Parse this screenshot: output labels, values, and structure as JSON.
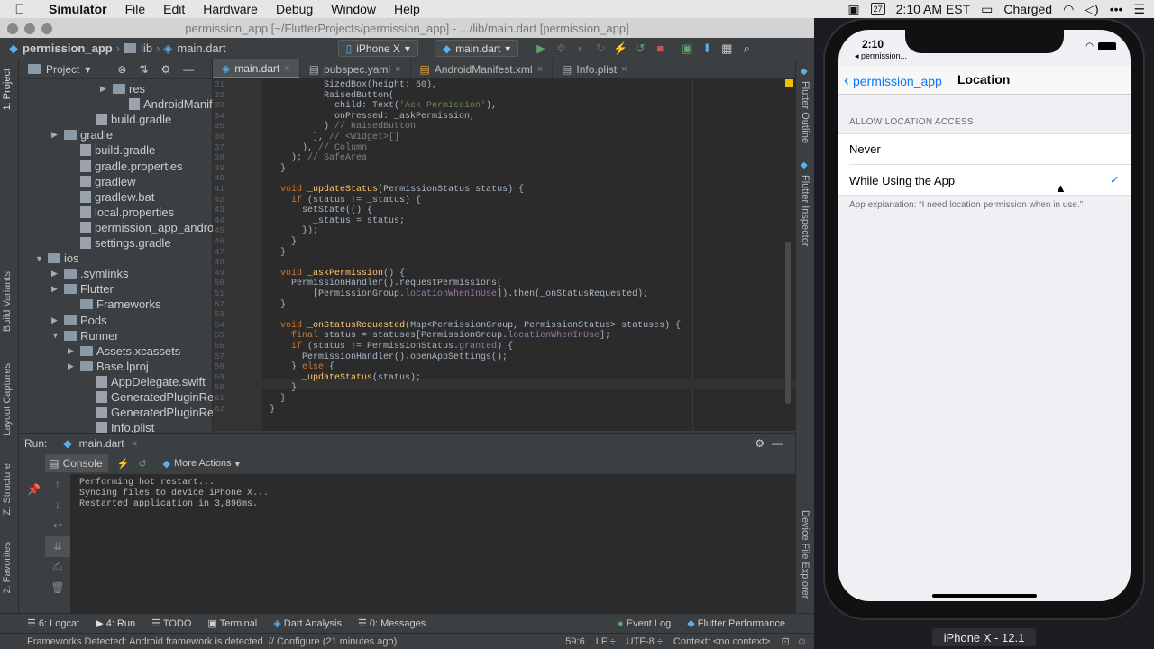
{
  "menubar": {
    "apple": "",
    "app": "Simulator",
    "items": [
      "File",
      "Edit",
      "Hardware",
      "Debug",
      "Window",
      "Help"
    ],
    "right": {
      "date_badge": "27",
      "clock": "2:10 AM EST",
      "battery": "Charged"
    }
  },
  "ide": {
    "title": "permission_app [~/FlutterProjects/permission_app] - .../lib/main.dart [permission_app]",
    "nav": {
      "crumbs": [
        "permission_app",
        "lib",
        "main.dart"
      ],
      "device": "iPhone X",
      "run_config": "main.dart"
    },
    "project": {
      "header": "Project",
      "tree": [
        {
          "label": "res",
          "depth": 5,
          "arrow": "▶",
          "kind": "folder"
        },
        {
          "label": "AndroidManifest.xml",
          "depth": 6,
          "arrow": "",
          "kind": "file"
        },
        {
          "label": "build.gradle",
          "depth": 4,
          "arrow": "",
          "kind": "file"
        },
        {
          "label": "gradle",
          "depth": 2,
          "arrow": "▶",
          "kind": "folder"
        },
        {
          "label": "build.gradle",
          "depth": 3,
          "arrow": "",
          "kind": "file"
        },
        {
          "label": "gradle.properties",
          "depth": 3,
          "arrow": "",
          "kind": "file"
        },
        {
          "label": "gradlew",
          "depth": 3,
          "arrow": "",
          "kind": "file"
        },
        {
          "label": "gradlew.bat",
          "depth": 3,
          "arrow": "",
          "kind": "file"
        },
        {
          "label": "local.properties",
          "depth": 3,
          "arrow": "",
          "kind": "file"
        },
        {
          "label": "permission_app_android",
          "depth": 3,
          "arrow": "",
          "kind": "file"
        },
        {
          "label": "settings.gradle",
          "depth": 3,
          "arrow": "",
          "kind": "file"
        },
        {
          "label": "ios",
          "depth": 1,
          "arrow": "▼",
          "kind": "folder"
        },
        {
          "label": ".symlinks",
          "depth": 2,
          "arrow": "▶",
          "kind": "folder"
        },
        {
          "label": "Flutter",
          "depth": 2,
          "arrow": "▶",
          "kind": "folder"
        },
        {
          "label": "Frameworks",
          "depth": 3,
          "arrow": "",
          "kind": "folder"
        },
        {
          "label": "Pods",
          "depth": 2,
          "arrow": "▶",
          "kind": "folder"
        },
        {
          "label": "Runner",
          "depth": 2,
          "arrow": "▼",
          "kind": "folder"
        },
        {
          "label": "Assets.xcassets",
          "depth": 3,
          "arrow": "▶",
          "kind": "folder"
        },
        {
          "label": "Base.lproj",
          "depth": 3,
          "arrow": "▶",
          "kind": "folder"
        },
        {
          "label": "AppDelegate.swift",
          "depth": 4,
          "arrow": "",
          "kind": "file"
        },
        {
          "label": "GeneratedPluginRegistrant.h",
          "depth": 4,
          "arrow": "",
          "kind": "file"
        },
        {
          "label": "GeneratedPluginRegistrant.m",
          "depth": 4,
          "arrow": "",
          "kind": "file"
        },
        {
          "label": "Info.plist",
          "depth": 4,
          "arrow": "",
          "kind": "file"
        }
      ]
    },
    "tabs": [
      {
        "label": "main.dart",
        "active": true
      },
      {
        "label": "pubspec.yaml",
        "active": false
      },
      {
        "label": "AndroidManifest.xml",
        "active": false
      },
      {
        "label": "Info.plist",
        "active": false
      }
    ],
    "code": {
      "lines": [
        {
          "n": "31",
          "t": "          SizedBox(height: 60),"
        },
        {
          "n": "32",
          "t": "          RaisedButton("
        },
        {
          "n": "33",
          "t": "            child: Text('Ask Permission'),"
        },
        {
          "n": "34",
          "t": "            onPressed: _askPermission,"
        },
        {
          "n": "35",
          "t": "          ) // RaisedButton"
        },
        {
          "n": "36",
          "t": "        ], // <Widget>[]"
        },
        {
          "n": "37",
          "t": "      ), // Column"
        },
        {
          "n": "38",
          "t": "    ); // SafeArea"
        },
        {
          "n": "39",
          "t": "  }"
        },
        {
          "n": "40",
          "t": ""
        },
        {
          "n": "41",
          "t": "  void _updateStatus(PermissionStatus status) {"
        },
        {
          "n": "42",
          "t": "    if (status != _status) {"
        },
        {
          "n": "43",
          "t": "      setState(() {"
        },
        {
          "n": "44",
          "t": "        _status = status;"
        },
        {
          "n": "45",
          "t": "      });"
        },
        {
          "n": "46",
          "t": "    }"
        },
        {
          "n": "47",
          "t": "  }"
        },
        {
          "n": "48",
          "t": ""
        },
        {
          "n": "49",
          "t": "  void _askPermission() {"
        },
        {
          "n": "50",
          "t": "    PermissionHandler().requestPermissions("
        },
        {
          "n": "51",
          "t": "        [PermissionGroup.locationWhenInUse]).then(_onStatusRequested);"
        },
        {
          "n": "52",
          "t": "  }"
        },
        {
          "n": "53",
          "t": ""
        },
        {
          "n": "54",
          "t": "  void _onStatusRequested(Map<PermissionGroup, PermissionStatus> statuses) {"
        },
        {
          "n": "55",
          "t": "    final status = statuses[PermissionGroup.locationWhenInUse];"
        },
        {
          "n": "56",
          "t": "    if (status != PermissionStatus.granted) {"
        },
        {
          "n": "57",
          "t": "      PermissionHandler().openAppSettings();"
        },
        {
          "n": "58",
          "t": "    } else {"
        },
        {
          "n": "59",
          "t": "      _updateStatus(status);"
        },
        {
          "n": "60",
          "t": "    }"
        },
        {
          "n": "61",
          "t": "  }"
        },
        {
          "n": "62",
          "t": "}"
        }
      ]
    },
    "side_tabs": {
      "left": [
        "1: Project",
        "Build Variants",
        "Layout Captures",
        "Z: Structure",
        "2: Favorites"
      ],
      "right": [
        "Flutter Outline",
        "Flutter Inspector",
        "Device File Explorer"
      ]
    },
    "run": {
      "label": "Run:",
      "config": "main.dart",
      "console_tab": "Console",
      "more_actions": "More Actions",
      "output": [
        "Performing hot restart...",
        "Syncing files to device iPhone X...",
        "Restarted application in 3,896ms."
      ]
    },
    "bottom_tabs": [
      "6: Logcat",
      "4: Run",
      "TODO",
      "Terminal",
      "Dart Analysis",
      "0: Messages"
    ],
    "bottom_right": [
      "Event Log",
      "Flutter Performance"
    ],
    "status": {
      "message": "Frameworks Detected: Android framework is detected. // Configure (21 minutes ago)",
      "position": "59:6",
      "line_sep": "LF ÷",
      "encoding": "UTF-8 ÷",
      "context": "Context: <no context>"
    }
  },
  "sim": {
    "time": "2:10",
    "back_app": "◂ permission...",
    "nav_back": "permission_app",
    "nav_title": "Location",
    "section": "ALLOW LOCATION ACCESS",
    "options": [
      {
        "label": "Never",
        "selected": false
      },
      {
        "label": "While Using the App",
        "selected": true
      }
    ],
    "explanation": "App explanation: “I need location permission when in use.”",
    "device_label": "iPhone X - 12.1"
  },
  "colors": {
    "accent": "#4a88c7",
    "ios_blue": "#0a7aff"
  }
}
